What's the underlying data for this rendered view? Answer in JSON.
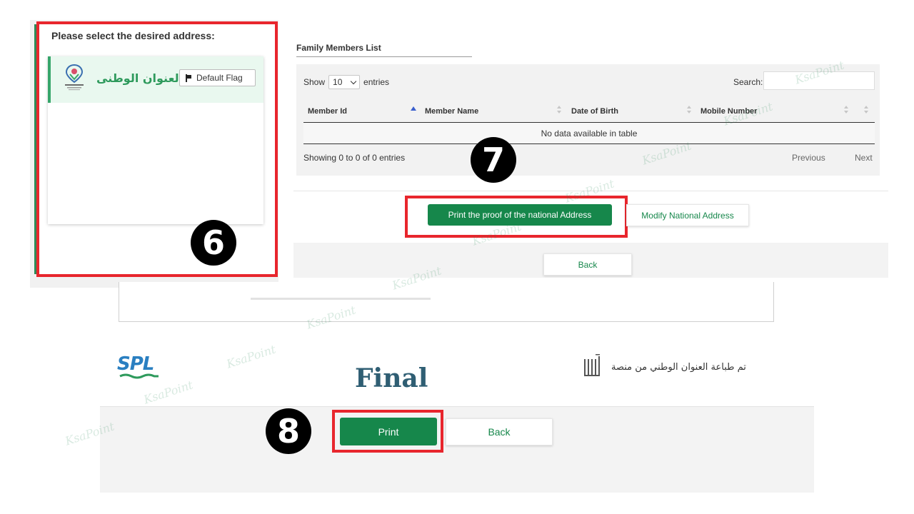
{
  "address_panel": {
    "title": "Please select the desired address:",
    "address_name": "العنوان الوطنى",
    "flag_button": "Default Flag",
    "step_badge": "6"
  },
  "family_panel": {
    "title": "Family Members List",
    "show_label": "Show",
    "entries_label": "entries",
    "page_size": "10",
    "search_label": "Search:",
    "search_value": "",
    "columns": [
      "Member Id",
      "Member Name",
      "Date of Birth",
      "Mobile Number"
    ],
    "empty_message": "No data available in table",
    "info": "Showing 0 to 0 of 0 entries",
    "previous": "Previous",
    "next": "Next",
    "print_proof_button": "Print the proof of the national Address",
    "modify_button": "Modify National Address",
    "back_button": "Back",
    "step_badge": "7"
  },
  "final_panel": {
    "spl_logo_text": "SPL",
    "title": "Final",
    "arabic_message": "تم طباعة العنوان الوطني من منصة",
    "print_button": "Print",
    "back_button": "Back",
    "step_badge": "8"
  },
  "watermark": "KsaPoint",
  "colors": {
    "highlight_red": "#e8262d",
    "primary_green": "#16874b",
    "selected_row_bg": "#e9f8ef",
    "final_title": "#2f5e73",
    "spl_blue": "#2a7fc1"
  },
  "icons": [
    "national-address-logo-icon",
    "flag-icon",
    "chevron-down-icon",
    "sort-icon",
    "sort-asc-icon",
    "spl-logo-icon",
    "absher-logo-icon"
  ]
}
